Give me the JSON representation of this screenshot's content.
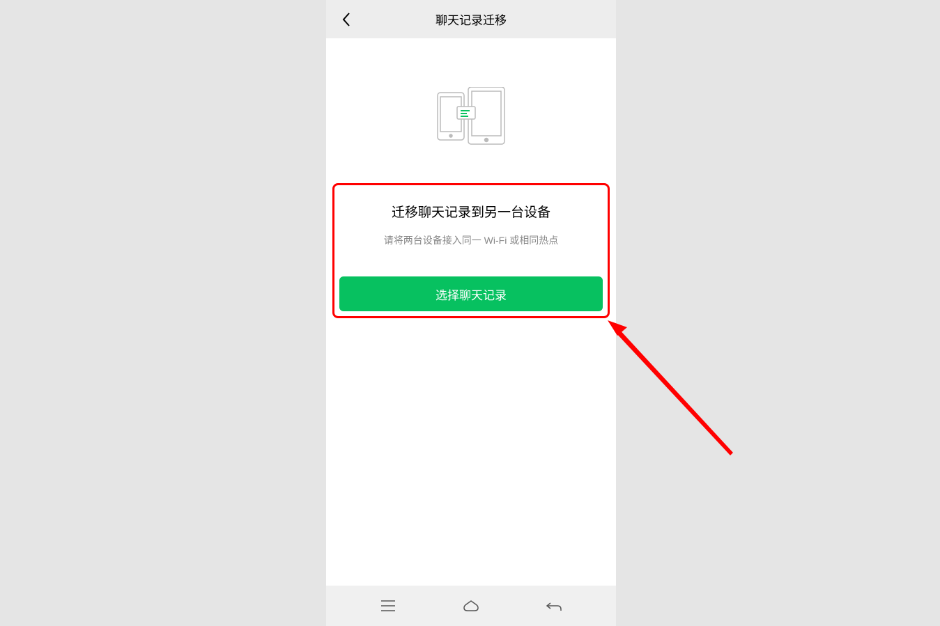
{
  "header": {
    "title": "聊天记录迁移"
  },
  "main": {
    "section_title": "迁移聊天记录到另一台设备",
    "section_subtitle": "请将两台设备接入同一 Wi-Fi 或相同热点",
    "button_label": "选择聊天记录"
  },
  "icons": {
    "back": "chevron-left-icon",
    "menu": "menu-icon",
    "home": "home-icon",
    "return": "return-icon"
  }
}
